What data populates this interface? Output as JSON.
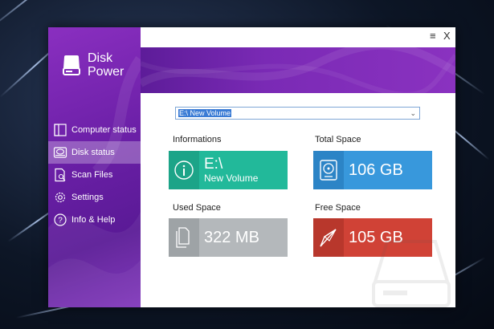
{
  "app": {
    "name_line1": "Disk",
    "name_line2": "Power",
    "logo_icon": "disk-drive-icon"
  },
  "window_controls": {
    "menu_icon": "≡",
    "close_icon": "X"
  },
  "nav": {
    "items": [
      {
        "label": "Computer status",
        "icon": "monitor-icon",
        "active": false
      },
      {
        "label": "Disk status",
        "icon": "hard-drive-icon",
        "active": true
      },
      {
        "label": "Scan Files",
        "icon": "document-search-icon",
        "active": false
      },
      {
        "label": "Settings",
        "icon": "gear-icon",
        "active": false
      },
      {
        "label": "Info & Help",
        "icon": "help-icon",
        "active": false
      }
    ]
  },
  "drive_select": {
    "value": "E:\\ New Volume"
  },
  "sections": {
    "informations": {
      "label": "Informations",
      "line1": "E:\\",
      "line2": "New Volume",
      "color": "#22b99a",
      "icon_bg": "#1ca488",
      "icon": "info-icon"
    },
    "total_space": {
      "label": "Total Space",
      "value": "106 GB",
      "color": "#3898dc",
      "icon_bg": "#2c84c6",
      "icon": "hard-disk-icon"
    },
    "used_space": {
      "label": "Used Space",
      "value": "322 MB",
      "color": "#b4b8bb",
      "icon_bg": "#9ea3a6",
      "icon": "documents-icon"
    },
    "free_space": {
      "label": "Free Space",
      "value": "105 GB",
      "color": "#d04236",
      "icon_bg": "#b8372c",
      "icon": "paper-plane-icon"
    }
  },
  "colors": {
    "sidebar": "#6a1fa6",
    "banner": "#7a2ab5",
    "accent": "#3a7bd5"
  }
}
